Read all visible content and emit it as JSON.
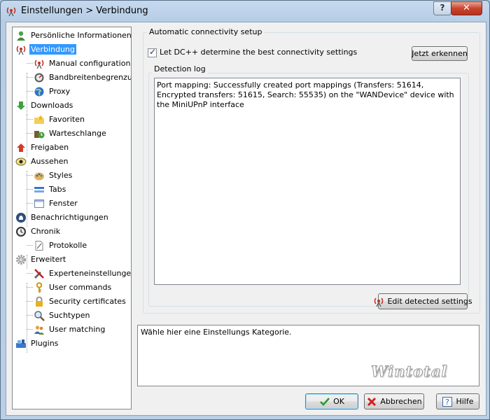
{
  "window": {
    "title": "Einstellungen > Verbindung",
    "help_button": "?",
    "close_button": "✕"
  },
  "tree": {
    "items": [
      {
        "label": "Persönliche Informationen",
        "icon": "person-icon"
      },
      {
        "label": "Verbindung",
        "icon": "antenna-icon",
        "selected": true
      },
      {
        "label": "Manual configuration",
        "icon": "antenna-icon"
      },
      {
        "label": "Bandbreitenbegrenzung",
        "icon": "gauge-icon"
      },
      {
        "label": "Proxy",
        "icon": "globe-icon"
      },
      {
        "label": "Downloads",
        "icon": "download-arrow-icon"
      },
      {
        "label": "Favoriten",
        "icon": "star-folder-icon"
      },
      {
        "label": "Warteschlange",
        "icon": "queue-clock-icon"
      },
      {
        "label": "Freigaben",
        "icon": "upload-arrow-icon"
      },
      {
        "label": "Aussehen",
        "icon": "eye-icon"
      },
      {
        "label": "Styles",
        "icon": "palette-icon"
      },
      {
        "label": "Tabs",
        "icon": "tabs-icon"
      },
      {
        "label": "Fenster",
        "icon": "window-icon"
      },
      {
        "label": "Benachrichtigungen",
        "icon": "notification-icon"
      },
      {
        "label": "Chronik",
        "icon": "history-clock-icon"
      },
      {
        "label": "Protokolle",
        "icon": "log-file-icon"
      },
      {
        "label": "Erweitert",
        "icon": "gear-icon"
      },
      {
        "label": "Experteneinstellungen",
        "icon": "tools-icon"
      },
      {
        "label": "User commands",
        "icon": "key-icon"
      },
      {
        "label": "Security certificates",
        "icon": "lock-icon"
      },
      {
        "label": "Suchtypen",
        "icon": "search-icon"
      },
      {
        "label": "User matching",
        "icon": "users-icon"
      },
      {
        "label": "Plugins",
        "icon": "plugin-icon"
      }
    ]
  },
  "connectivity": {
    "group_label": "Automatic connectivity setup",
    "checkbox_label": "Let DC++ determine the best connectivity settings",
    "checkbox_checked": true,
    "detect_button": "Jetzt erkennen",
    "log_label": "Detection log",
    "log_text": "Port mapping: Successfully created port mappings (Transfers: 51614, Encrypted transfers: 51615, Search: 55535) on the \"WANDevice\" device with the MiniUPnP interface",
    "edit_button": "Edit detected settings"
  },
  "description": {
    "text": "Wähle hier eine Einstellungs Kategorie.",
    "watermark": "Wintotal"
  },
  "footer": {
    "ok_label": "OK",
    "cancel_label": "Abbrechen",
    "help_label": "Hilfe"
  },
  "colors": {
    "selection": "#3399ff",
    "titlebar": "#c6d9ee",
    "close_button": "#c9442f"
  }
}
